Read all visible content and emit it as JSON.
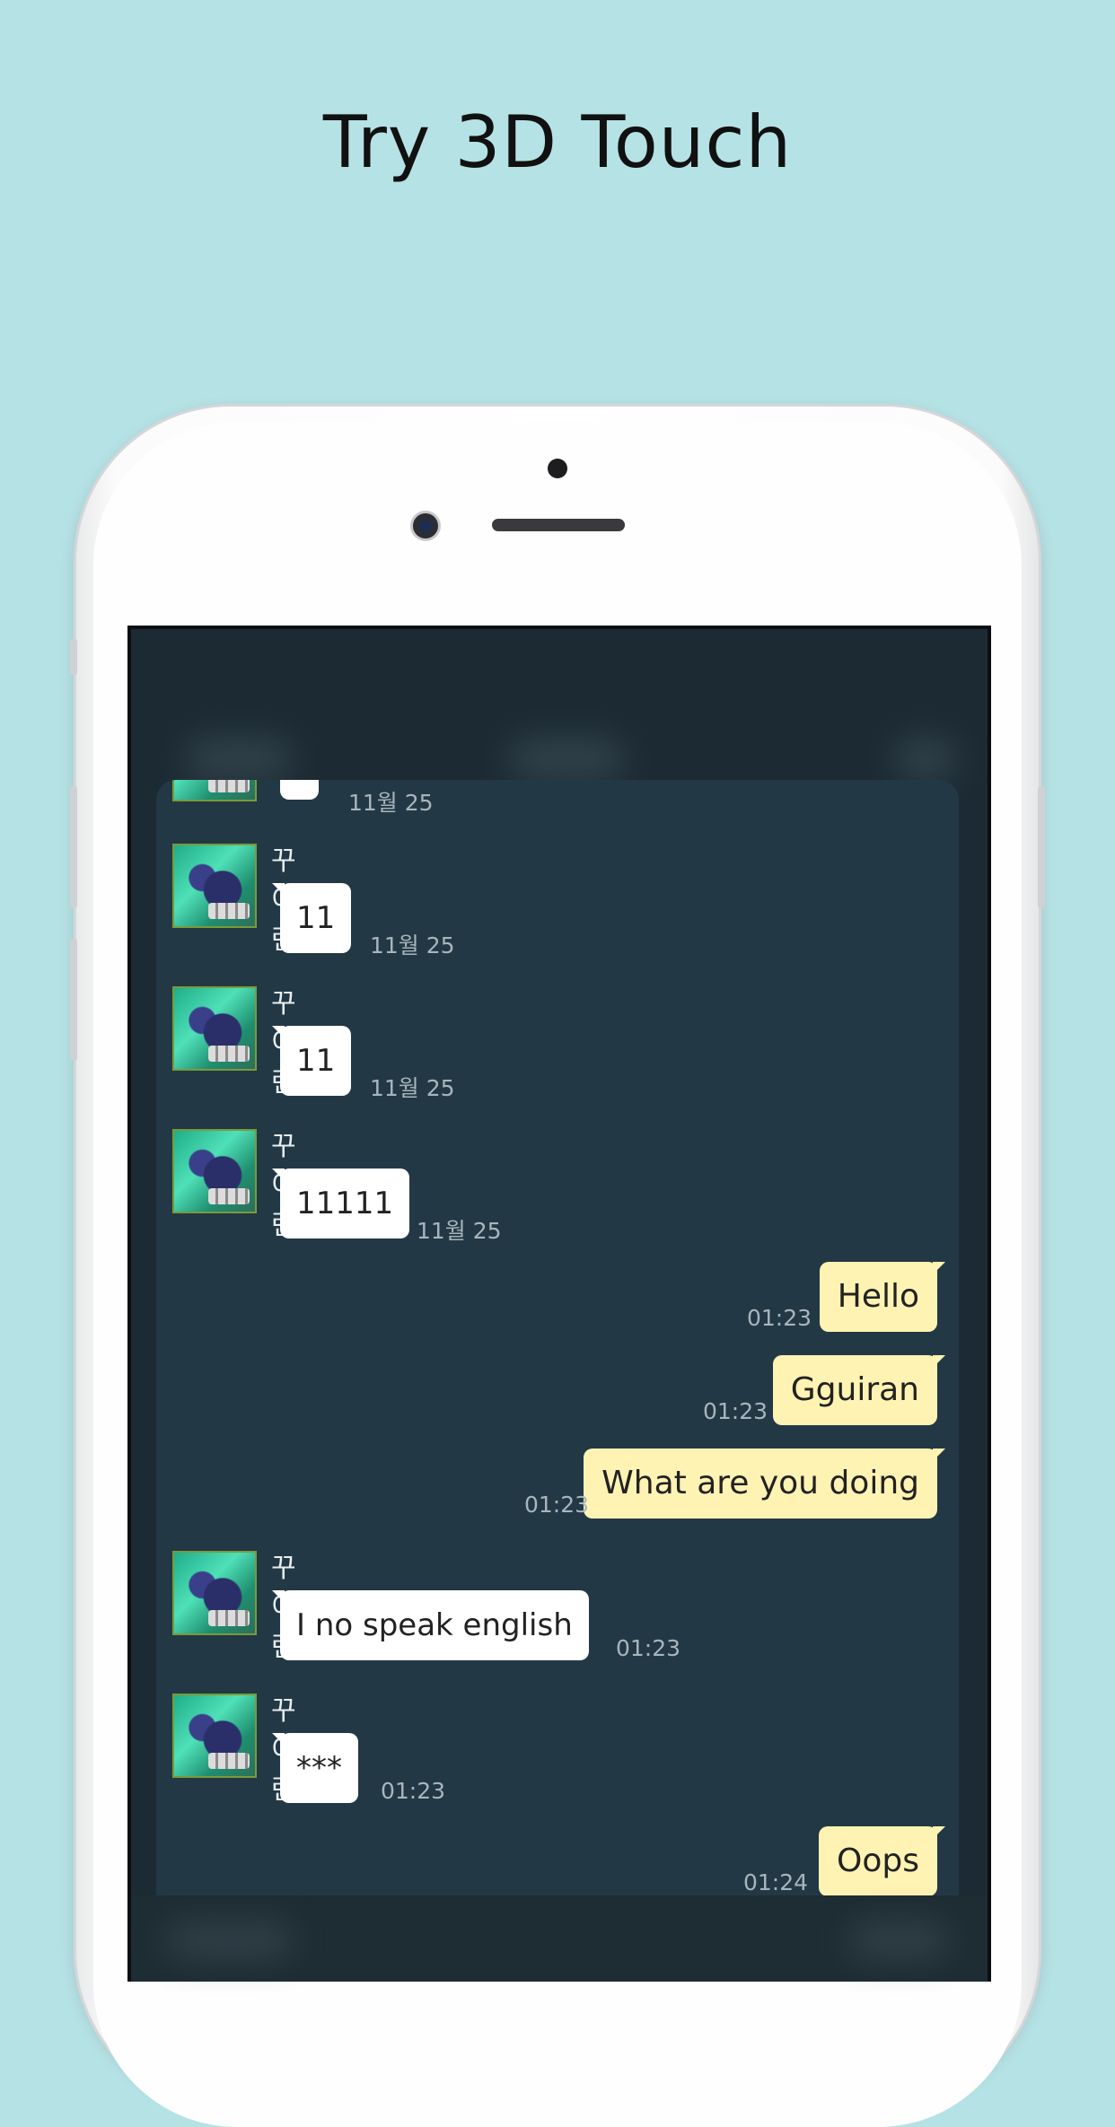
{
  "headline": "Try 3D Touch",
  "chat": {
    "partial_message": {
      "text": "’",
      "time": "11월 25"
    },
    "messages": [
      {
        "direction": "in",
        "sender": "꾸이란",
        "text": "11",
        "time": "11월 25"
      },
      {
        "direction": "in",
        "sender": "꾸이란",
        "text": "11",
        "time": "11월 25"
      },
      {
        "direction": "in",
        "sender": "꾸이란",
        "text": "11111",
        "time": "11월 25"
      },
      {
        "direction": "out",
        "text": "Hello",
        "time": "01:23"
      },
      {
        "direction": "out",
        "text": "Gguiran",
        "time": "01:23"
      },
      {
        "direction": "out",
        "text": "What are you doing",
        "time": "01:23"
      },
      {
        "direction": "in",
        "sender": "꾸이란",
        "text": "I no speak english",
        "time": "01:23"
      },
      {
        "direction": "in",
        "sender": "꾸이란",
        "text": "***",
        "time": "01:23"
      },
      {
        "direction": "out",
        "text": "Oops",
        "time": "01:24"
      }
    ]
  },
  "colors": {
    "background": "#b5e2e5",
    "chat_bg": "#223845",
    "incoming_bubble": "#ffffff",
    "outgoing_bubble": "#fff3b3"
  }
}
